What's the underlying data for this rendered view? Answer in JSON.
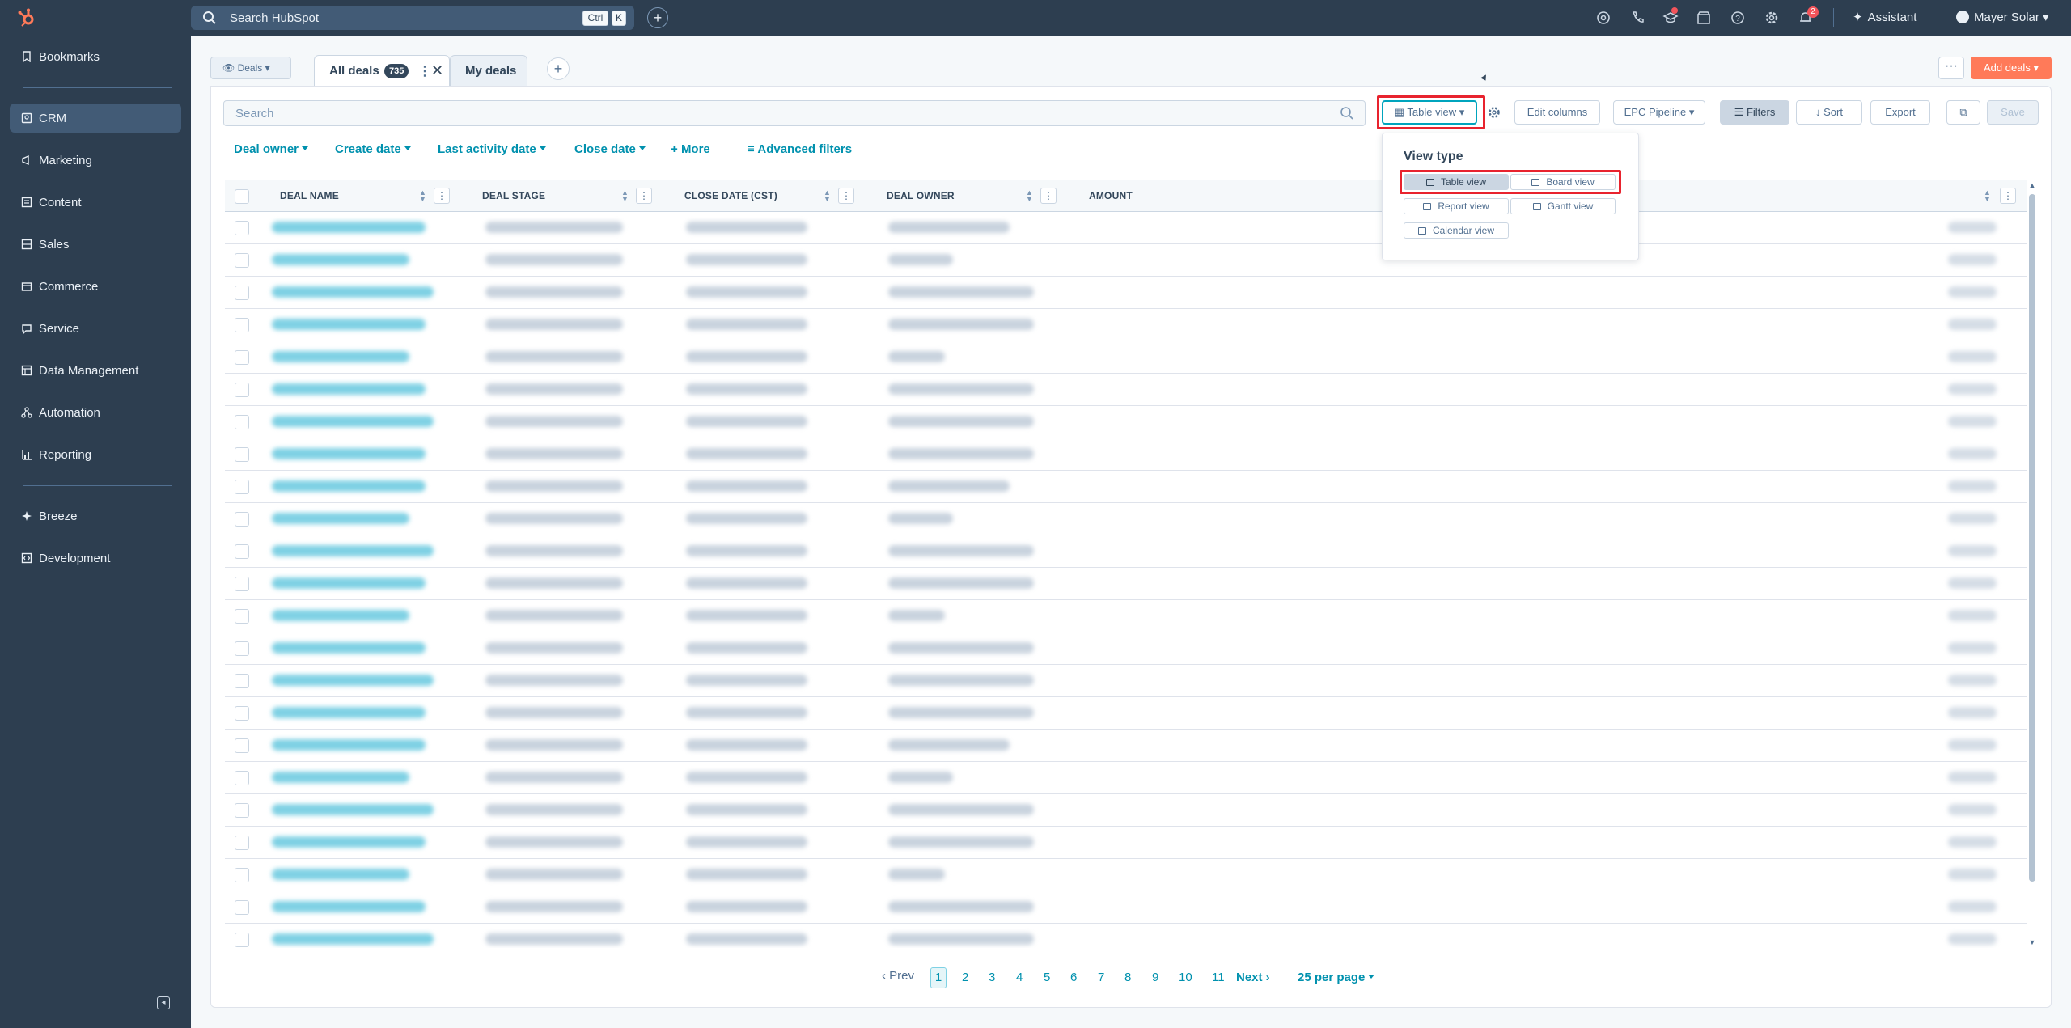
{
  "topbar": {
    "search_placeholder": "Search HubSpot",
    "kbd_ctrl": "Ctrl",
    "kbd_k": "K",
    "notification_count": "2",
    "assistant_label": "Assistant",
    "account_name": "Mayer Solar"
  },
  "sidebar": {
    "items": [
      {
        "label": "Bookmarks",
        "icon": "bookmark-icon"
      },
      {
        "label": "CRM",
        "icon": "crm-icon"
      },
      {
        "label": "Marketing",
        "icon": "megaphone-icon"
      },
      {
        "label": "Content",
        "icon": "content-icon"
      },
      {
        "label": "Sales",
        "icon": "sales-icon"
      },
      {
        "label": "Commerce",
        "icon": "cart-icon"
      },
      {
        "label": "Service",
        "icon": "service-icon"
      },
      {
        "label": "Data Management",
        "icon": "database-icon"
      },
      {
        "label": "Automation",
        "icon": "automation-icon"
      },
      {
        "label": "Reporting",
        "icon": "chart-icon"
      },
      {
        "label": "Breeze",
        "icon": "breeze-icon"
      },
      {
        "label": "Development",
        "icon": "code-icon"
      }
    ]
  },
  "header": {
    "object_select": "Deals",
    "tabs": [
      {
        "label": "All deals",
        "count": "735"
      },
      {
        "label": "My deals"
      }
    ],
    "add_button": "Add deals"
  },
  "toolbar": {
    "search_placeholder": "Search",
    "view_button": "Table view",
    "edit_columns": "Edit columns",
    "pipeline": "EPC Pipeline",
    "filters": "Filters",
    "sort": "Sort",
    "export": "Export",
    "save": "Save"
  },
  "filters": {
    "chips": [
      "Deal owner",
      "Create date",
      "Last activity date",
      "Close date"
    ],
    "more": "More",
    "advanced": "Advanced filters"
  },
  "table": {
    "columns": [
      "DEAL NAME",
      "DEAL STAGE",
      "CLOSE DATE (CST)",
      "DEAL OWNER",
      "AMOUNT"
    ]
  },
  "view_dropdown": {
    "title": "View type",
    "options": [
      "Table view",
      "Board view",
      "Report view",
      "Gantt view",
      "Calendar view"
    ],
    "selected": "Table view"
  },
  "pagination": {
    "prev": "Prev",
    "pages": [
      "1",
      "2",
      "3",
      "4",
      "5",
      "6",
      "7",
      "8",
      "9",
      "10",
      "11"
    ],
    "current": "1",
    "next": "Next",
    "per_page": "25 per page"
  },
  "colors": {
    "nav_bg": "#2d3e50",
    "accent_link": "#0091ae",
    "primary_cta": "#ff7a59",
    "highlight_outline": "#e8232e"
  }
}
